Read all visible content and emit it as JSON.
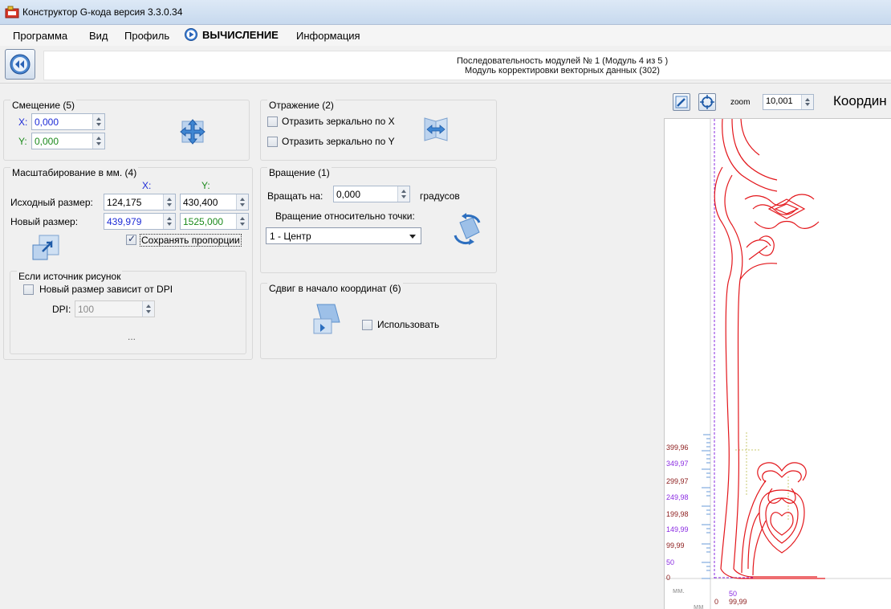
{
  "window": {
    "title": "Конструктор G-кода версия 3.3.0.34"
  },
  "menu": {
    "program": "Программа",
    "view": "Вид",
    "profile": "Профиль",
    "calculation": "ВЫЧИСЛЕНИЕ",
    "info": "Информация"
  },
  "sequence": {
    "line1": "Последовательность модулей № 1 (Модуль 4 из 5 )",
    "line2": "Модуль корректировки векторных данных (302)"
  },
  "offset": {
    "title": "Смещение (5)",
    "x_label": "X:",
    "x_value": "0,000",
    "y_label": "Y:",
    "y_value": "0,000"
  },
  "mirror": {
    "title": "Отражение (2)",
    "mirror_x": "Отразить зеркально по X",
    "mirror_y": "Отразить зеркально по Y",
    "mirror_x_checked": false,
    "mirror_y_checked": false
  },
  "scale": {
    "title": "Масштабирование в мм. (4)",
    "col_x": "X:",
    "col_y": "Y:",
    "source_label": "Исходный размер:",
    "source_x": "124,175",
    "source_y": "430,400",
    "new_label": "Новый размер:",
    "new_x": "439,979",
    "new_y": "1525,000",
    "keep_proportions": "Сохранять пропорции",
    "keep_proportions_checked": true,
    "image_source_title": "Если источник рисунок",
    "dpi_dependent": "Новый размер зависит от DPI",
    "dpi_dependent_checked": false,
    "dpi_label": "DPI:",
    "dpi_value": "100",
    "more": "..."
  },
  "rotation": {
    "title": "Вращение (1)",
    "rotate_label": "Вращать на:",
    "rotate_value": "0,000",
    "unit": "градусов",
    "point_label": "Вращение относительно точки:",
    "point_value": "1 - Центр"
  },
  "origin_shift": {
    "title": "Сдвиг в начало координат (6)",
    "use_label": "Использовать",
    "use_checked": false
  },
  "viewer": {
    "zoom_label": "zoom",
    "zoom_value": "10,001",
    "coords_title": "Координ",
    "unit_label": "мм.",
    "unit_label2": "мм",
    "y_ticks": [
      "399,96",
      "349,97",
      "299,97",
      "249,98",
      "199,98",
      "149,99",
      "99,99",
      "50",
      "0"
    ],
    "x_ticks": [
      "0",
      "50",
      "99,99"
    ]
  },
  "colors": {
    "accent_blue": "#1d2bd6",
    "accent_green": "#1c8a1c",
    "drawing_red": "#e3161b",
    "tick_purple": "#8a2be2",
    "tick_brown": "#8b1a1a"
  }
}
